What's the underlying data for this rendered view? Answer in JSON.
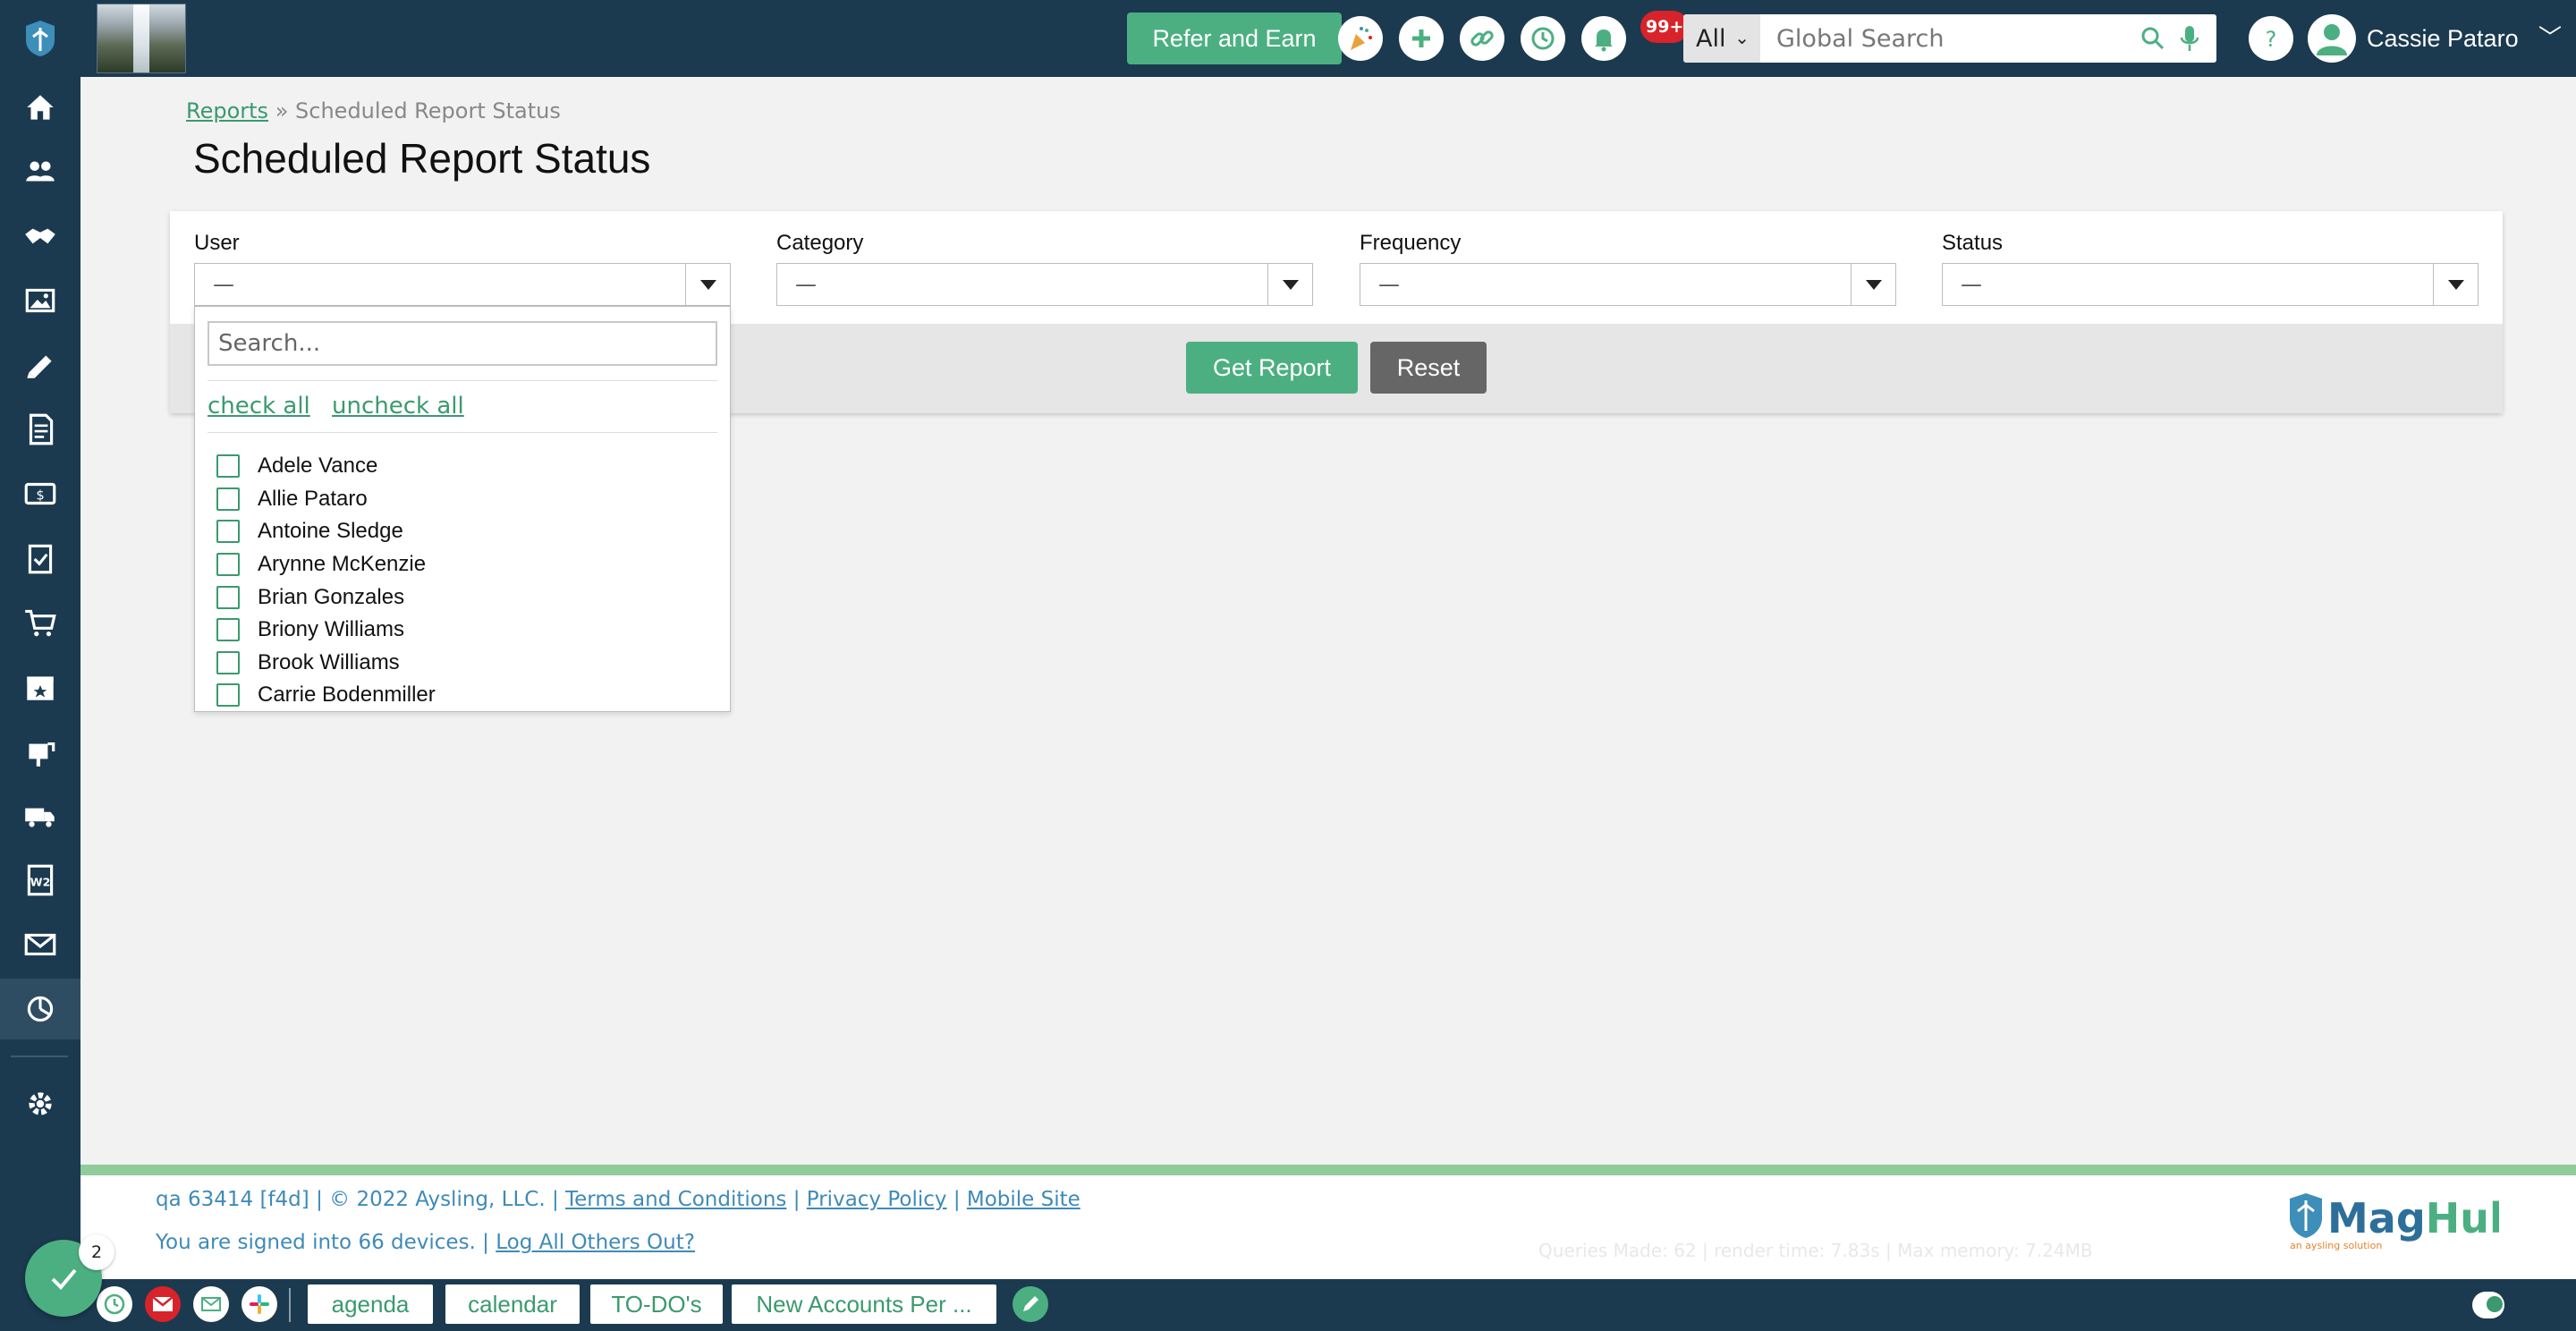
{
  "sidebar": {
    "items": [
      {
        "name": "home-icon"
      },
      {
        "name": "contacts-icon"
      },
      {
        "name": "handshake-icon"
      },
      {
        "name": "media-icon"
      },
      {
        "name": "ruler-pencil-icon"
      },
      {
        "name": "invoice-icon"
      },
      {
        "name": "payments-icon"
      },
      {
        "name": "clipboard-check-icon"
      },
      {
        "name": "cart-icon"
      },
      {
        "name": "calendar-star-icon"
      },
      {
        "name": "mailbox-icon"
      },
      {
        "name": "delivery-truck-icon"
      },
      {
        "name": "w2-form-icon"
      },
      {
        "name": "mail-icon"
      },
      {
        "name": "reports-icon"
      },
      {
        "name": "settings-icon"
      }
    ]
  },
  "topbar": {
    "refer_label": "Refer and Earn",
    "notification_badge": "99+",
    "search_scope": "All",
    "search_placeholder": "Global Search",
    "user_name": "Cassie Pataro"
  },
  "breadcrumb": {
    "root": "Reports",
    "separator": "»",
    "current": "Scheduled Report Status"
  },
  "page_title": "Scheduled Report Status",
  "filters": {
    "user": {
      "label": "User",
      "value": "—"
    },
    "category": {
      "label": "Category",
      "value": "—"
    },
    "frequency": {
      "label": "Frequency",
      "value": "—"
    },
    "status": {
      "label": "Status",
      "value": "—"
    }
  },
  "actions": {
    "get_report": "Get Report",
    "reset": "Reset"
  },
  "user_dropdown": {
    "search_placeholder": "Search...",
    "check_all": "check all",
    "uncheck_all": "uncheck all",
    "options": [
      "Adele Vance",
      "Allie Pataro",
      "Antoine Sledge",
      "Arynne McKenzie",
      "Brian Gonzales",
      "Briony Williams",
      "Brook Williams",
      "Carrie Bodenmiller"
    ]
  },
  "footer": {
    "build": "qa 63414 [f4d] | © 2022 Aysling, LLC. |",
    "terms": "Terms and Conditions",
    "privacy": "Privacy Policy",
    "mobile": "Mobile Site",
    "signed_in": "You are signed into 66 devices. |",
    "log_out_others": "Log All Others Out?",
    "debug": "Queries Made: 62 | render time: 7.83s | Max memory: 7.24MB",
    "brand": "MagHub",
    "brand_tagline": "an aysling solution"
  },
  "bottombar": {
    "tabs": [
      "agenda",
      "calendar",
      "TO-DO's",
      "New Accounts Per ..."
    ],
    "todo_count": "2"
  },
  "colors": {
    "navy": "#1b3a50",
    "accent_green": "#4caf82",
    "link_green": "#3a9a6e",
    "badge_red": "#d8232a"
  }
}
